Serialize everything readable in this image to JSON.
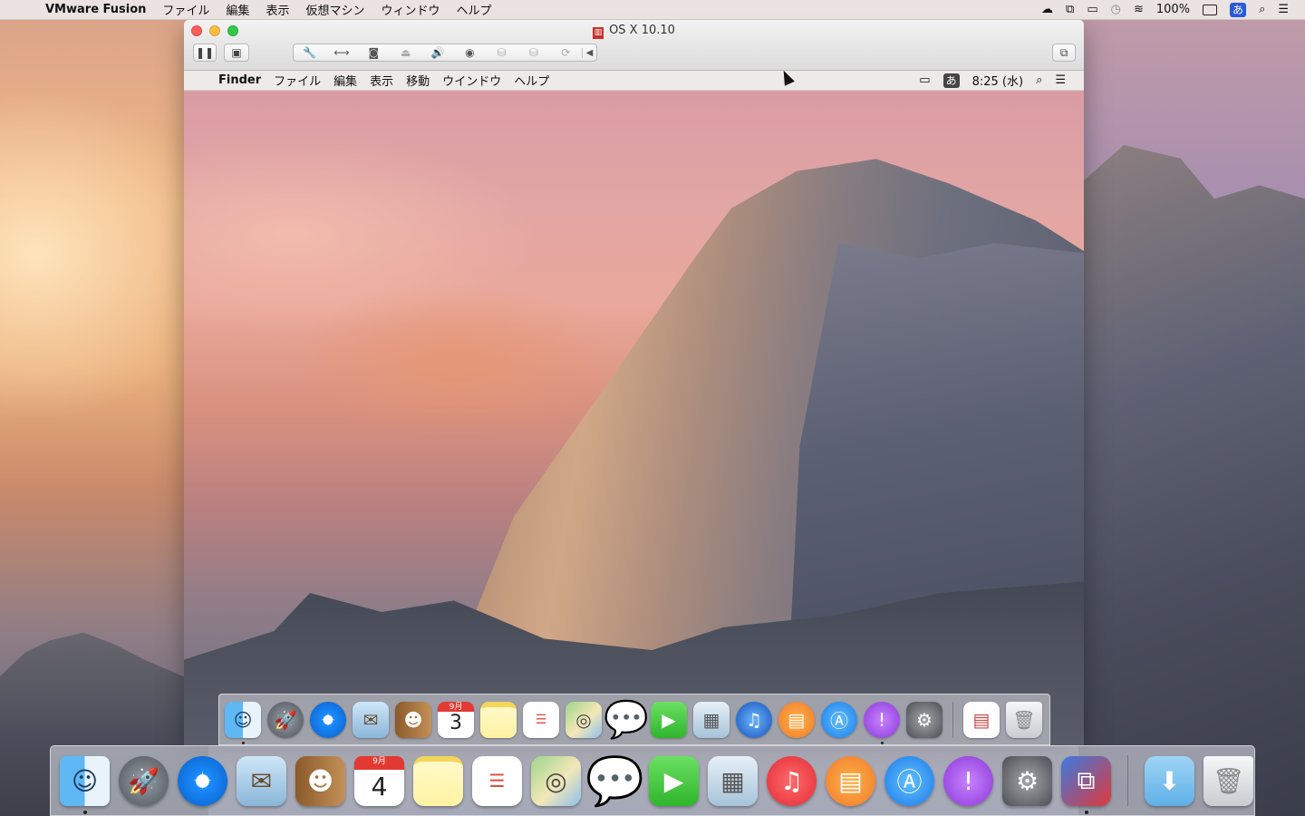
{
  "host": {
    "menubar": {
      "app_name": "VMware Fusion",
      "menus": [
        "ファイル",
        "編集",
        "表示",
        "仮想マシン",
        "ウィンドウ",
        "ヘルプ"
      ],
      "battery": "100%",
      "ime": "あ",
      "icons": [
        "cloud-icon",
        "vmware-status-icon",
        "airplay-icon",
        "time-machine-icon",
        "wifi-icon",
        "battery-icon",
        "ime-icon",
        "spotlight-icon",
        "notification-center-icon"
      ]
    },
    "dock": {
      "calendar_month": "9月",
      "calendar_day": "4",
      "apps": [
        "Finder",
        "Launchpad",
        "Safari",
        "Mail",
        "Contacts",
        "Calendar",
        "Notes",
        "Reminders",
        "Maps",
        "Messages",
        "FaceTime",
        "Preview",
        "iTunes",
        "iBooks",
        "App Store",
        "Feedback Assistant",
        "System Preferences",
        "VMware Fusion",
        "Downloads",
        "Trash"
      ]
    }
  },
  "vm": {
    "title": "OS X 10.10",
    "toolbar_icons": [
      "pause-icon",
      "snapshot-icon",
      "settings-icon",
      "network-icon",
      "disk-icon",
      "cd-icon",
      "sound-icon",
      "camera-icon",
      "usb-icon",
      "usb2-icon",
      "refresh-icon",
      "collapse-arrow-icon",
      "fullscreen-icon"
    ]
  },
  "guest": {
    "menubar": {
      "app_name": "Finder",
      "menus": [
        "ファイル",
        "編集",
        "表示",
        "移動",
        "ウインドウ",
        "ヘルプ"
      ],
      "ime": "あ",
      "clock": "8:25 (水)"
    },
    "dock": {
      "calendar_month": "9月",
      "calendar_day": "3",
      "apps": [
        "Finder",
        "Launchpad",
        "Safari",
        "Mail",
        "Contacts",
        "Calendar",
        "Notes",
        "Reminders",
        "Maps",
        "Messages",
        "FaceTime",
        "Preview",
        "iTunes",
        "iBooks",
        "App Store",
        "Feedback Assistant",
        "System Preferences",
        "Document",
        "Trash"
      ]
    }
  }
}
